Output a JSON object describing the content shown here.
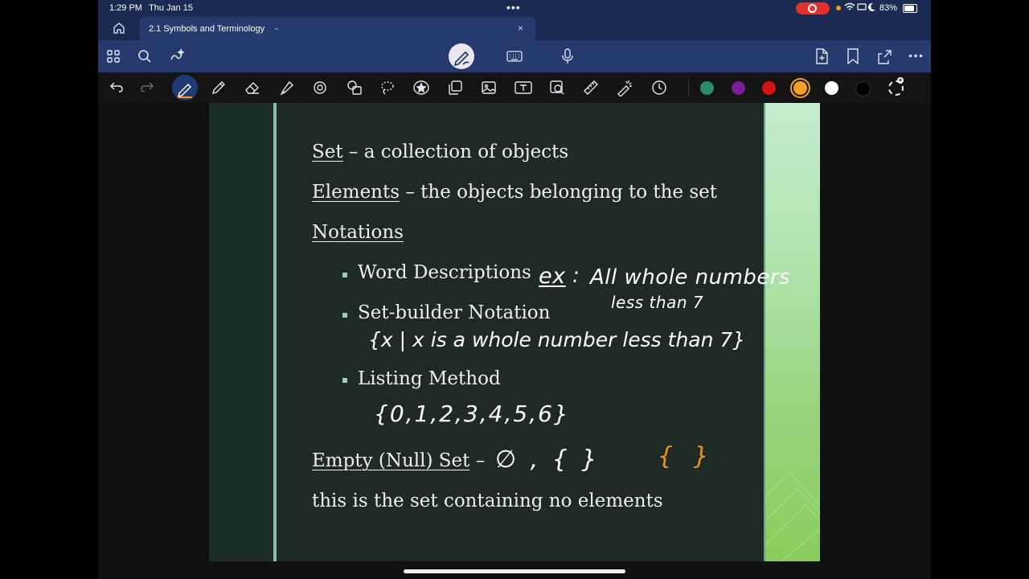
{
  "status_bar": {
    "time": "1:29 PM",
    "date": "Thu Jan 15",
    "dots": "•••",
    "battery": "83%"
  },
  "tab_bar": {
    "tab_title": "2.1 Symbols and Terminology",
    "close": "×",
    "chevron": "⌄"
  },
  "toolbar": {
    "colors": [
      "#2e8b6f",
      "#7c1d99",
      "#d11414",
      "#f0a024",
      "#ffffff",
      "#000000"
    ],
    "selected_color": "#f0a024"
  },
  "slide": {
    "set_term": "Set",
    "set_def": " – a collection of objects",
    "elements_term": "Elements",
    "elements_def": " – the objects belonging to the set",
    "notations_heading": "Notations",
    "bullet1": "Word Descriptions",
    "bullet2": "Set-builder Notation",
    "bullet3": "Listing Method",
    "empty_term": "Empty (Null) Set",
    "empty_dash": " –",
    "empty_def": "this is the set containing no elements"
  },
  "ink": {
    "ex_label": "ex",
    "ex_colon": ":",
    "word_line1": "All whole numbers",
    "word_line2": "less than 7",
    "set_builder": "{x | x is a whole number less than 7}",
    "listing": "{0,1,2,3,4,5,6}",
    "empty_symbols": "∅ , { }",
    "empty_orange": "{ }"
  }
}
